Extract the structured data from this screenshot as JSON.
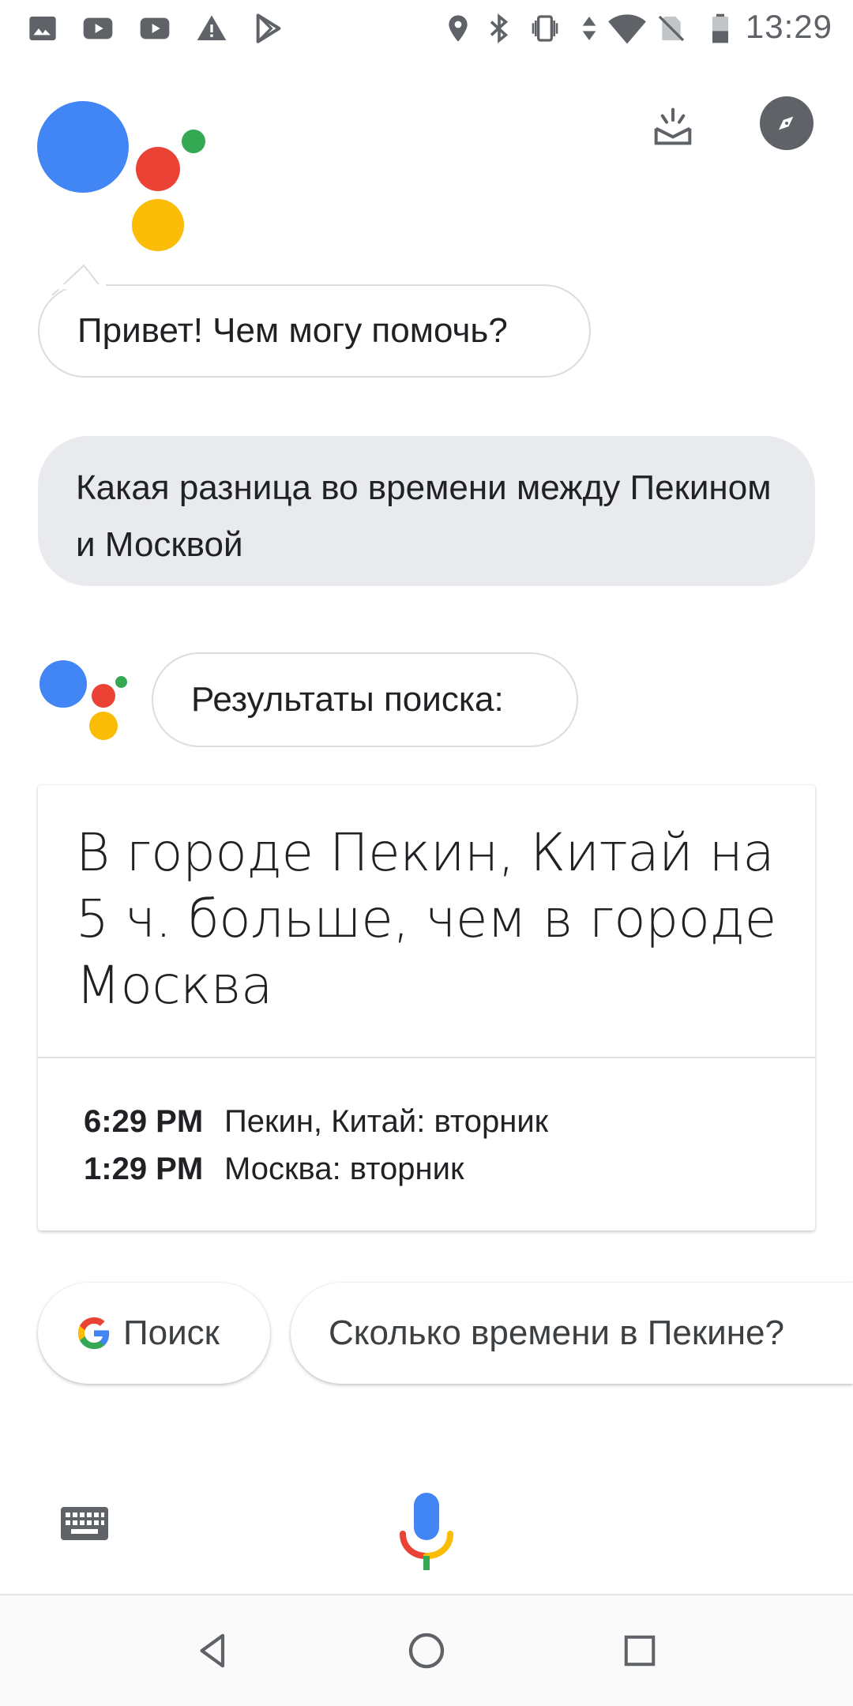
{
  "status_bar": {
    "time": "13:29",
    "left_icons": [
      "photo-icon",
      "youtube-icon",
      "youtube-icon",
      "warning-icon",
      "play-store-icon"
    ],
    "right_icons": [
      "location-icon",
      "bluetooth-icon",
      "vibrate-icon",
      "data-arrows-icon",
      "wifi-icon",
      "no-sim-icon",
      "battery-icon"
    ]
  },
  "assistant": {
    "greeting": "Привет! Чем могу помочь?",
    "user_query": "Какая разница во времени между Пекином и Москвой",
    "results_label": "Результаты поиска:"
  },
  "result_card": {
    "headline": "В городе Пекин, Китай на 5 ч. больше, чем в городе Москва",
    "rows": [
      {
        "time": "6:29 PM",
        "place": "Пекин, Китай: вторник"
      },
      {
        "time": "1:29 PM",
        "place": "Москва: вторник"
      }
    ]
  },
  "chips": {
    "search_label": "Поиск",
    "suggestion": "Сколько времени в Пекине?"
  },
  "colors": {
    "blue": "#4285f4",
    "red": "#ea4335",
    "yellow": "#fbbc05",
    "green": "#34a853"
  }
}
